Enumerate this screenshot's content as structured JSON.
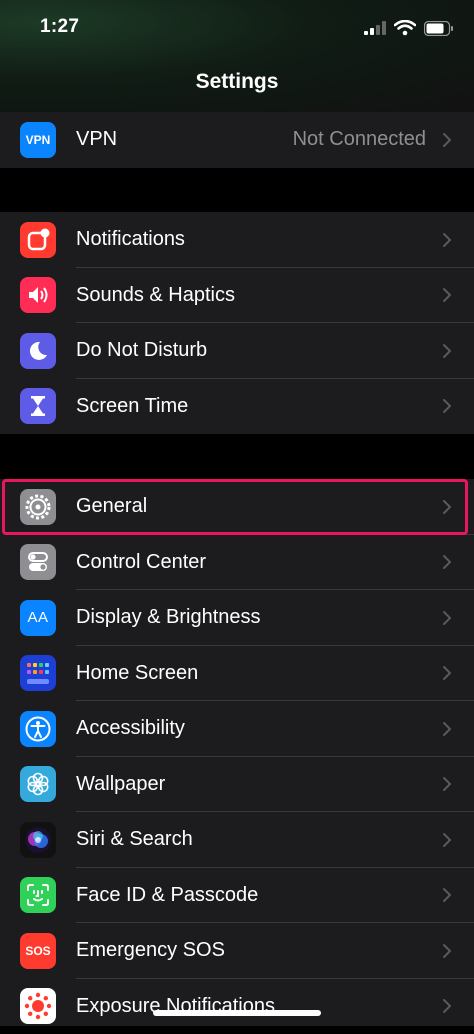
{
  "status_bar": {
    "time": "1:27"
  },
  "nav": {
    "title": "Settings"
  },
  "vpn_group": [
    {
      "label": "VPN",
      "value": "Not Connected",
      "icon": "vpn-icon",
      "icon_text": "VPN",
      "color": "#0a84ff"
    }
  ],
  "group1": [
    {
      "label": "Notifications",
      "icon": "notifications-icon",
      "color": "#ff3b30"
    },
    {
      "label": "Sounds & Haptics",
      "icon": "speaker-icon",
      "color": "#ff2d55"
    },
    {
      "label": "Do Not Disturb",
      "icon": "moon-icon",
      "color": "#5e5ce6"
    },
    {
      "label": "Screen Time",
      "icon": "hourglass-icon",
      "color": "#5e5ce6"
    }
  ],
  "group2": [
    {
      "label": "General",
      "icon": "gear-icon",
      "color": "#8e8e93"
    },
    {
      "label": "Control Center",
      "icon": "toggles-icon",
      "color": "#8e8e93"
    },
    {
      "label": "Display & Brightness",
      "icon": "text-size-icon",
      "icon_text": "AA",
      "color": "#0a84ff"
    },
    {
      "label": "Home Screen",
      "icon": "home-grid-icon",
      "color": "#1d3fd6"
    },
    {
      "label": "Accessibility",
      "icon": "accessibility-icon",
      "color": "#0a84ff"
    },
    {
      "label": "Wallpaper",
      "icon": "flower-icon",
      "color": "#34aadc"
    },
    {
      "label": "Siri & Search",
      "icon": "siri-icon",
      "color": "#1c1c1e"
    },
    {
      "label": "Face ID & Passcode",
      "icon": "face-id-icon",
      "color": "#30d158"
    },
    {
      "label": "Emergency SOS",
      "icon": "sos-icon",
      "icon_text": "SOS",
      "color": "#ff3b30"
    },
    {
      "label": "Exposure Notifications",
      "icon": "exposure-icon",
      "color": "#ffffff"
    }
  ]
}
